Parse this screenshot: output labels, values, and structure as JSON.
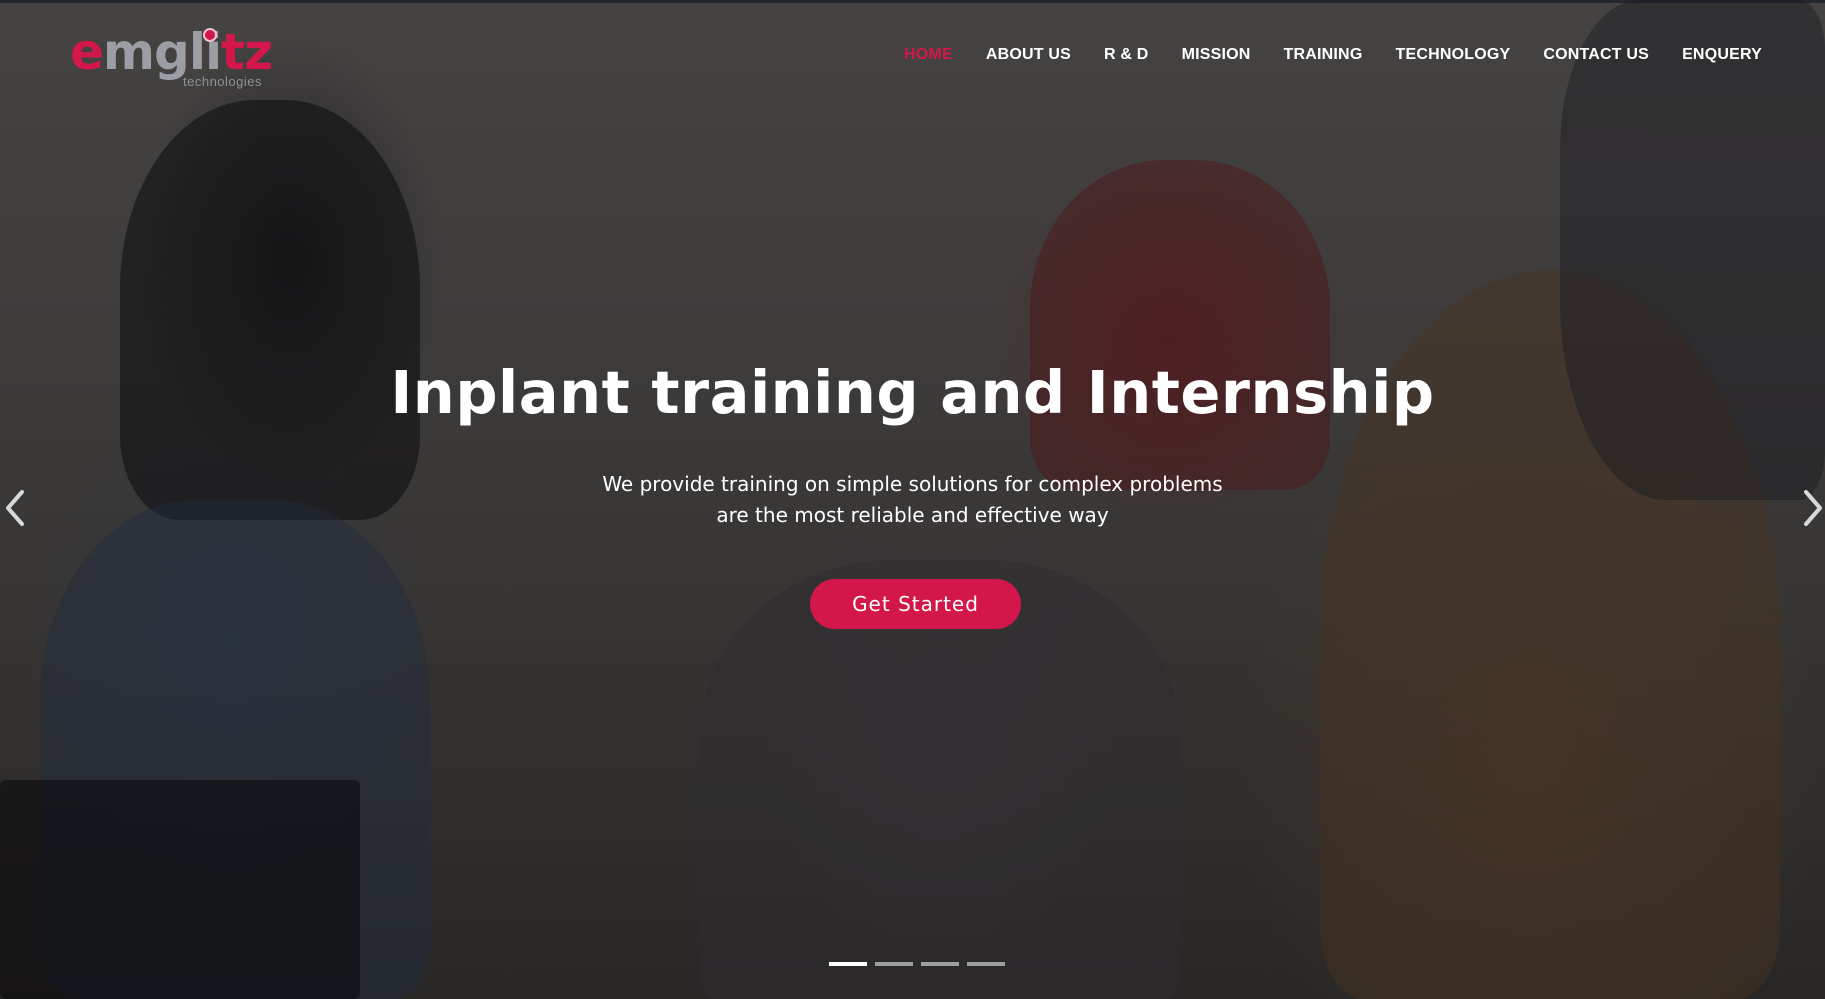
{
  "logo": {
    "e": "e",
    "mid": "mgli",
    "end": "tz",
    "subtitle": "technologies"
  },
  "nav": {
    "items": [
      {
        "label": "HOME",
        "active": true
      },
      {
        "label": "ABOUT US"
      },
      {
        "label": "R & D"
      },
      {
        "label": "MISSION"
      },
      {
        "label": "TRAINING"
      },
      {
        "label": "TECHNOLOGY"
      },
      {
        "label": "CONTACT US"
      },
      {
        "label": "ENQUERY"
      }
    ]
  },
  "hero": {
    "title": "Inplant training and Internship",
    "subtitle_line1": "We provide training on simple solutions for complex problems",
    "subtitle_line2": "are the most reliable and effective way",
    "cta_label": "Get Started"
  },
  "carousel": {
    "prev_icon": "chevron-left-icon",
    "next_icon": "chevron-right-icon",
    "slides": 4,
    "active_slide": 1
  },
  "colors": {
    "accent": "#d4174a",
    "logo_gray": "#9b9ea5",
    "text": "#ffffff"
  }
}
